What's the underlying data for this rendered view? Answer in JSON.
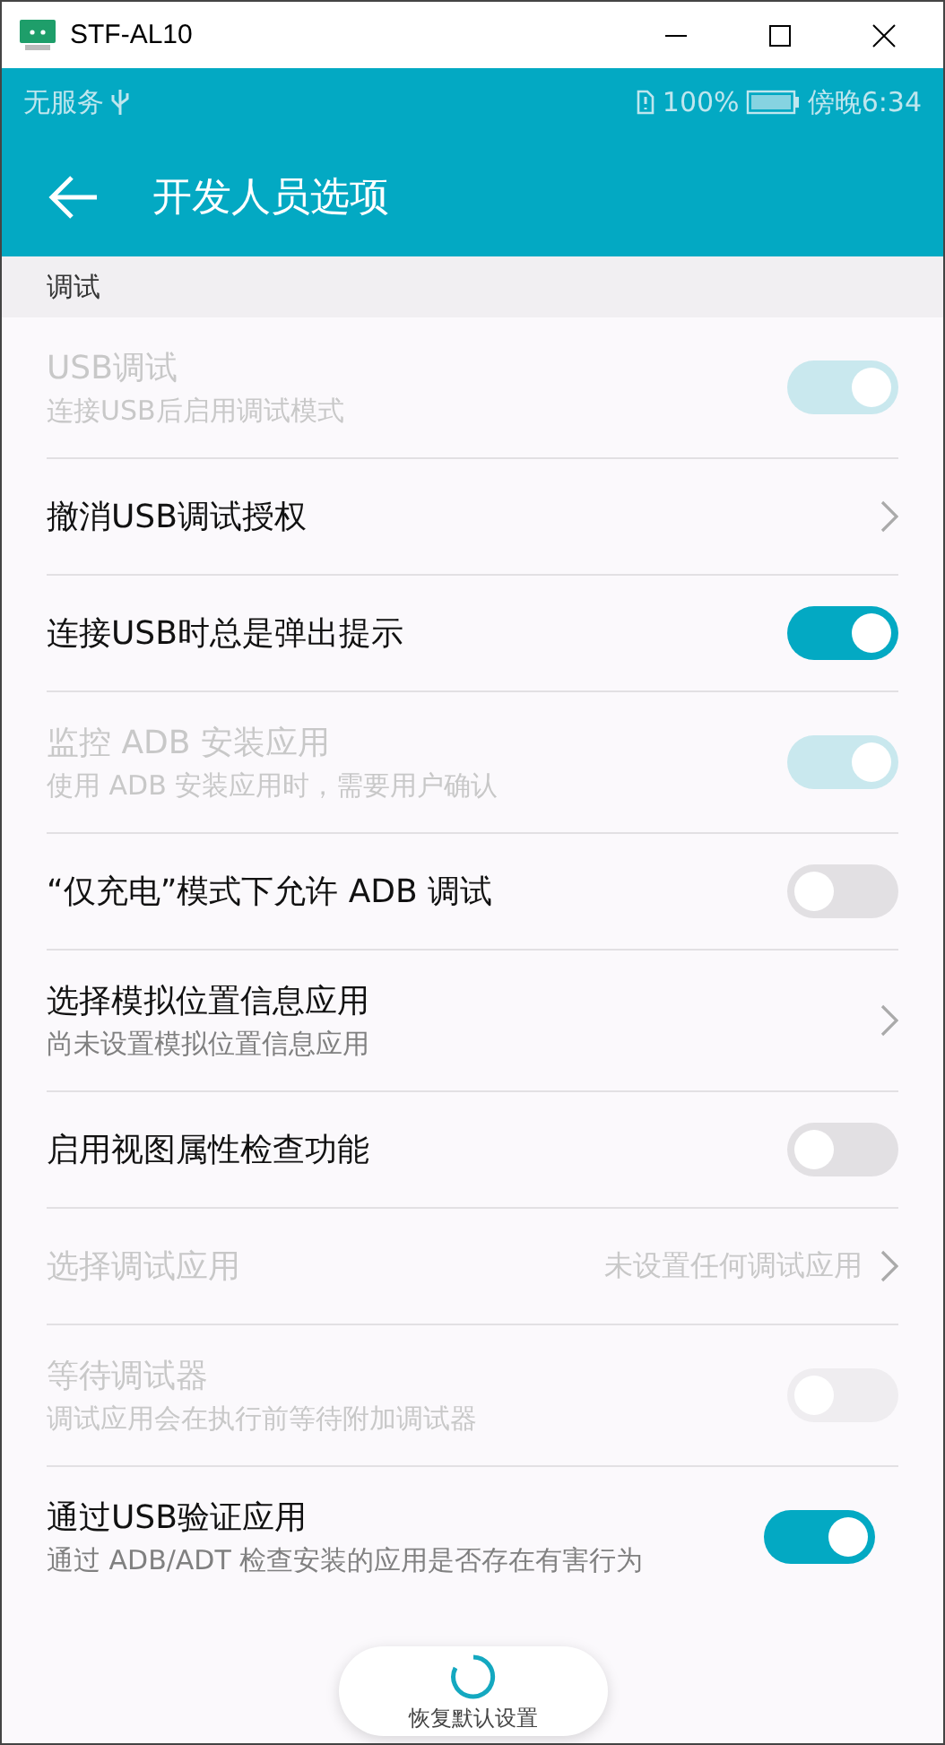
{
  "window": {
    "title": "STF-AL10"
  },
  "status_bar": {
    "carrier": "无服务",
    "battery": "100%",
    "time": "傍晚6:34"
  },
  "app_bar": {
    "title": "开发人员选项"
  },
  "section": {
    "title": "调试"
  },
  "rows": [
    {
      "kind": "switch",
      "title": "USB调试",
      "subtitle": "连接USB后启用调试模式",
      "on": true,
      "disabled": true
    },
    {
      "kind": "link",
      "title": "撤消USB调试授权",
      "disabled": false
    },
    {
      "kind": "switch",
      "title": "连接USB时总是弹出提示",
      "on": true,
      "disabled": false
    },
    {
      "kind": "switch",
      "title": "监控 ADB 安装应用",
      "subtitle": "使用 ADB 安装应用时，需要用户确认",
      "on": true,
      "disabled": true
    },
    {
      "kind": "switch",
      "title": "“仅充电”模式下允许 ADB 调试",
      "on": false,
      "disabled": false
    },
    {
      "kind": "link",
      "title": "选择模拟位置信息应用",
      "subtitle": "尚未设置模拟位置信息应用",
      "disabled": false
    },
    {
      "kind": "switch",
      "title": "启用视图属性检查功能",
      "on": false,
      "disabled": false
    },
    {
      "kind": "link",
      "title": "选择调试应用",
      "value": "未设置任何调试应用",
      "disabled": true
    },
    {
      "kind": "switch",
      "title": "等待调试器",
      "subtitle": "调试应用会在执行前等待附加调试器",
      "on": false,
      "disabled": true
    },
    {
      "kind": "switch",
      "title": "通过USB验证应用",
      "subtitle": "通过 ADB/ADT 检查安装的应用是否存在有害行为",
      "on": true,
      "disabled": false
    }
  ],
  "toast": {
    "label": "恢复默认设置"
  }
}
